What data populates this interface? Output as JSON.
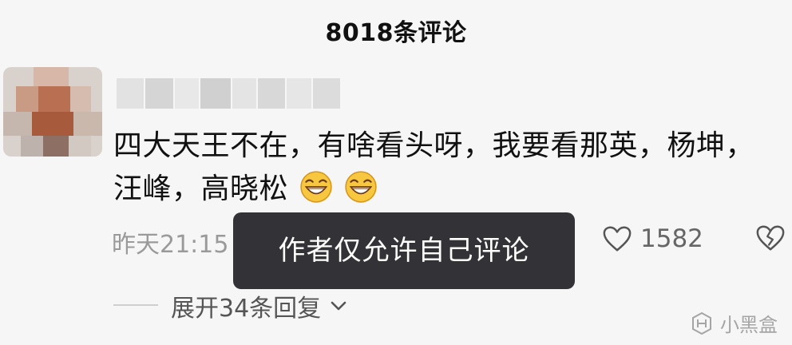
{
  "header": {
    "title": "8018条评论"
  },
  "comment": {
    "avatar_icon": "blurred-avatar",
    "username_icon": "blurred-username",
    "text": "四大天王不在，有啥看头呀，我要看那英，杨坤，汪峰，高晓松",
    "emoji": [
      "grinning-emoji",
      "grinning-emoji"
    ],
    "timestamp": "昨天21:15",
    "like_icon": "heart-outline-icon",
    "like_count": "1582",
    "dislike_icon": "broken-heart-icon"
  },
  "toast": {
    "message": "作者仅允许自己评论"
  },
  "replies": {
    "expand_label": "展开34条回复",
    "chevron_icon": "chevron-down-icon"
  },
  "watermark": {
    "label": "小黑盒",
    "logo_icon": "heybox-logo"
  },
  "colors": {
    "background": "#f6f6f6",
    "toast_background": "#26262a",
    "toast_text": "#ffffff",
    "secondary_text": "#9a9a9a"
  }
}
